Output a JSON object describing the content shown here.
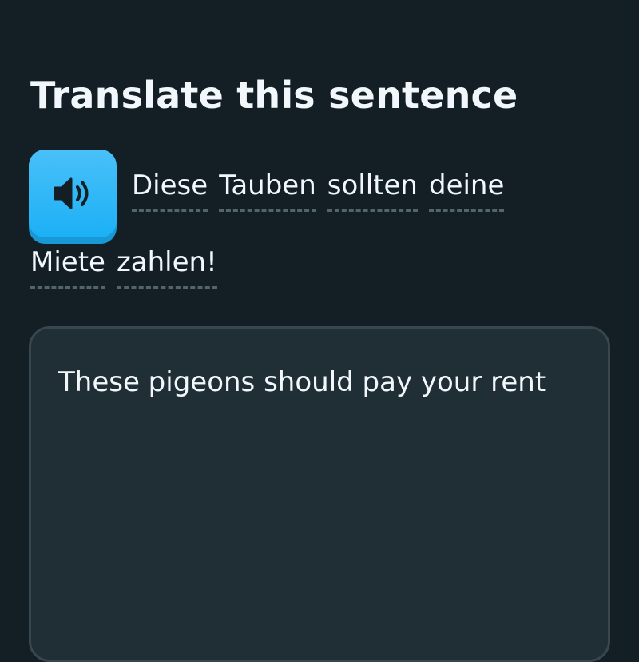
{
  "exercise": {
    "title": "Translate this sentence",
    "speaker_icon": "speaker-icon",
    "prompt_words": [
      "Diese",
      "Tauben",
      "sollten",
      "deine",
      "Miete",
      "zahlen!"
    ],
    "answer_value": "These pigeons should pay your rent"
  },
  "colors": {
    "background": "#131f24",
    "text": "#f1f7fb",
    "speaker_button": "#1cb0f6",
    "answer_box": "#202f36",
    "answer_border": "#37464f",
    "word_underline": "#52656d"
  }
}
